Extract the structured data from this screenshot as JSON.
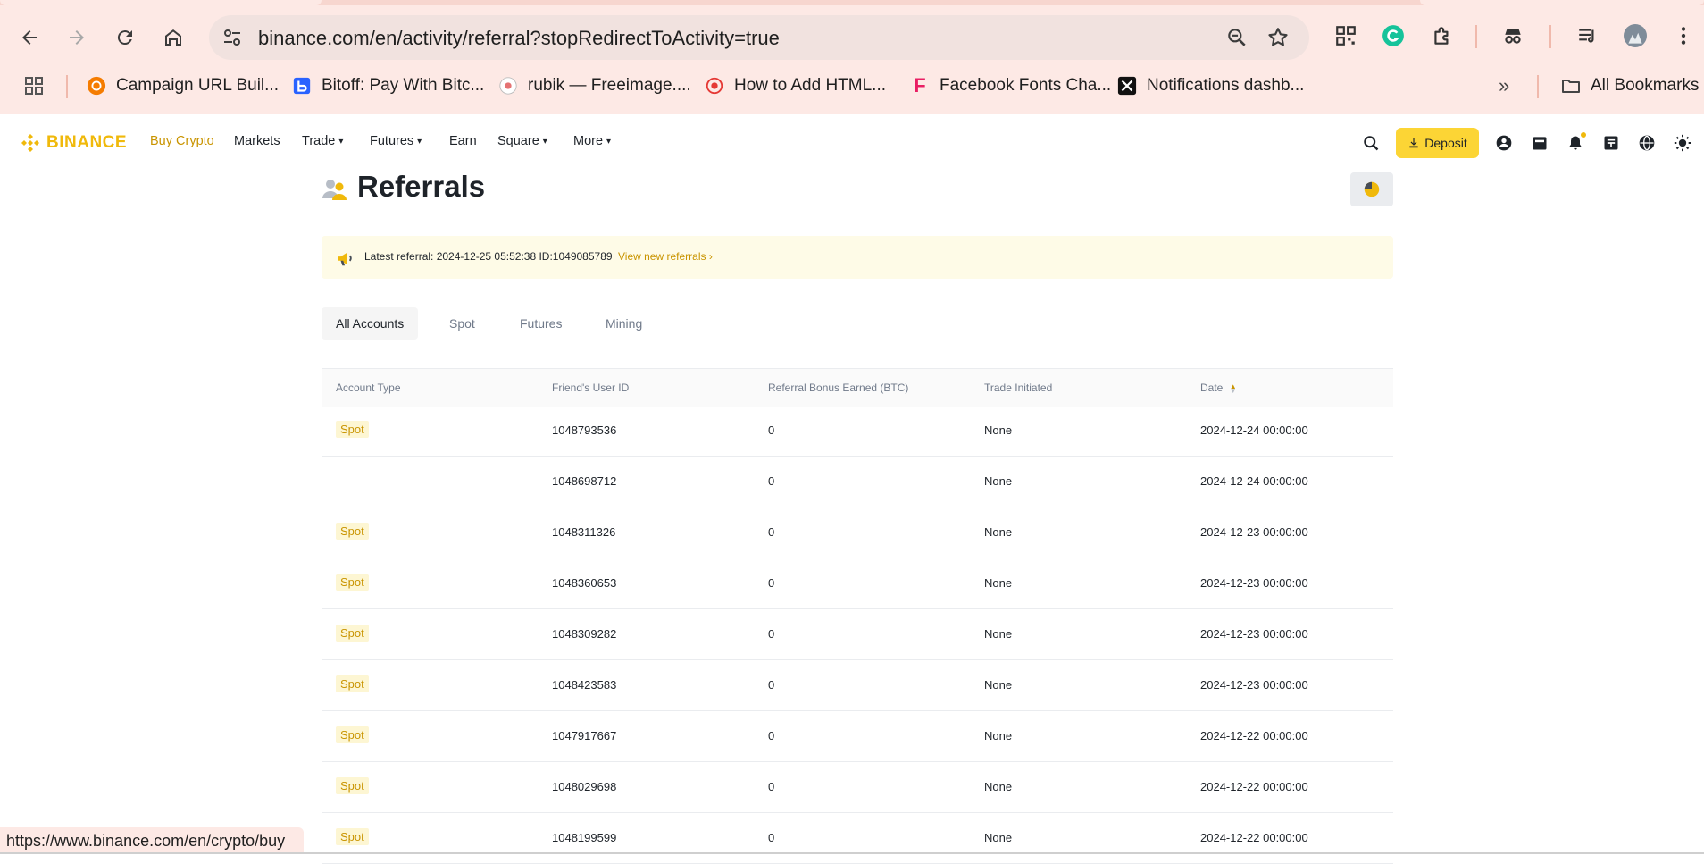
{
  "browser": {
    "url": "binance.com/en/activity/referral?stopRedirectToActivity=true",
    "bookmarks": [
      {
        "label": "Campaign URL Buil...",
        "icon": "campaign-favicon"
      },
      {
        "label": "Bitoff: Pay With Bitc...",
        "icon": "bitoff-favicon"
      },
      {
        "label": "rubik — Freeimage....",
        "icon": "freeimage-favicon"
      },
      {
        "label": "How to Add HTML...",
        "icon": "html-favicon"
      },
      {
        "label": "Facebook Fonts Cha...",
        "icon": "fonts-favicon"
      },
      {
        "label": "Notifications dashb...",
        "icon": "notifications-favicon"
      }
    ],
    "all_bookmarks": "All Bookmarks",
    "status_url": "https://www.binance.com/en/crypto/buy"
  },
  "header": {
    "logo": "BINANCE",
    "nav": [
      {
        "label": "Buy Crypto",
        "dropdown": false
      },
      {
        "label": "Markets",
        "dropdown": false
      },
      {
        "label": "Trade",
        "dropdown": true
      },
      {
        "label": "Futures",
        "dropdown": true
      },
      {
        "label": "Earn",
        "dropdown": false
      },
      {
        "label": "Square",
        "dropdown": true
      },
      {
        "label": "More",
        "dropdown": true
      }
    ],
    "deposit_label": "Deposit",
    "accent": "#fcd535",
    "brand": "#f0b90b"
  },
  "page": {
    "title": "Referrals",
    "banner": {
      "text": "Latest referral: 2024-12-25 05:52:38   ID:1049085789",
      "link": "View new referrals ›"
    },
    "tabs": [
      "All Accounts",
      "Spot",
      "Futures",
      "Mining"
    ],
    "active_tab": "All Accounts",
    "columns": [
      "Account Type",
      "Friend's User ID",
      "Referral Bonus Earned (BTC)",
      "Trade Initiated",
      "Date"
    ],
    "rows": [
      {
        "type": "Spot",
        "id": "1048793536",
        "bonus": "0",
        "trade": "None",
        "date": "2024-12-24 00:00:00"
      },
      {
        "type": "",
        "id": "1048698712",
        "bonus": "0",
        "trade": "None",
        "date": "2024-12-24 00:00:00"
      },
      {
        "type": "Spot",
        "id": "1048311326",
        "bonus": "0",
        "trade": "None",
        "date": "2024-12-23 00:00:00"
      },
      {
        "type": "Spot",
        "id": "1048360653",
        "bonus": "0",
        "trade": "None",
        "date": "2024-12-23 00:00:00"
      },
      {
        "type": "Spot",
        "id": "1048309282",
        "bonus": "0",
        "trade": "None",
        "date": "2024-12-23 00:00:00"
      },
      {
        "type": "Spot",
        "id": "1048423583",
        "bonus": "0",
        "trade": "None",
        "date": "2024-12-23 00:00:00"
      },
      {
        "type": "Spot",
        "id": "1047917667",
        "bonus": "0",
        "trade": "None",
        "date": "2024-12-22 00:00:00"
      },
      {
        "type": "Spot",
        "id": "1048029698",
        "bonus": "0",
        "trade": "None",
        "date": "2024-12-22 00:00:00"
      },
      {
        "type": "Spot",
        "id": "1048199599",
        "bonus": "0",
        "trade": "None",
        "date": "2024-12-22 00:00:00"
      }
    ]
  }
}
